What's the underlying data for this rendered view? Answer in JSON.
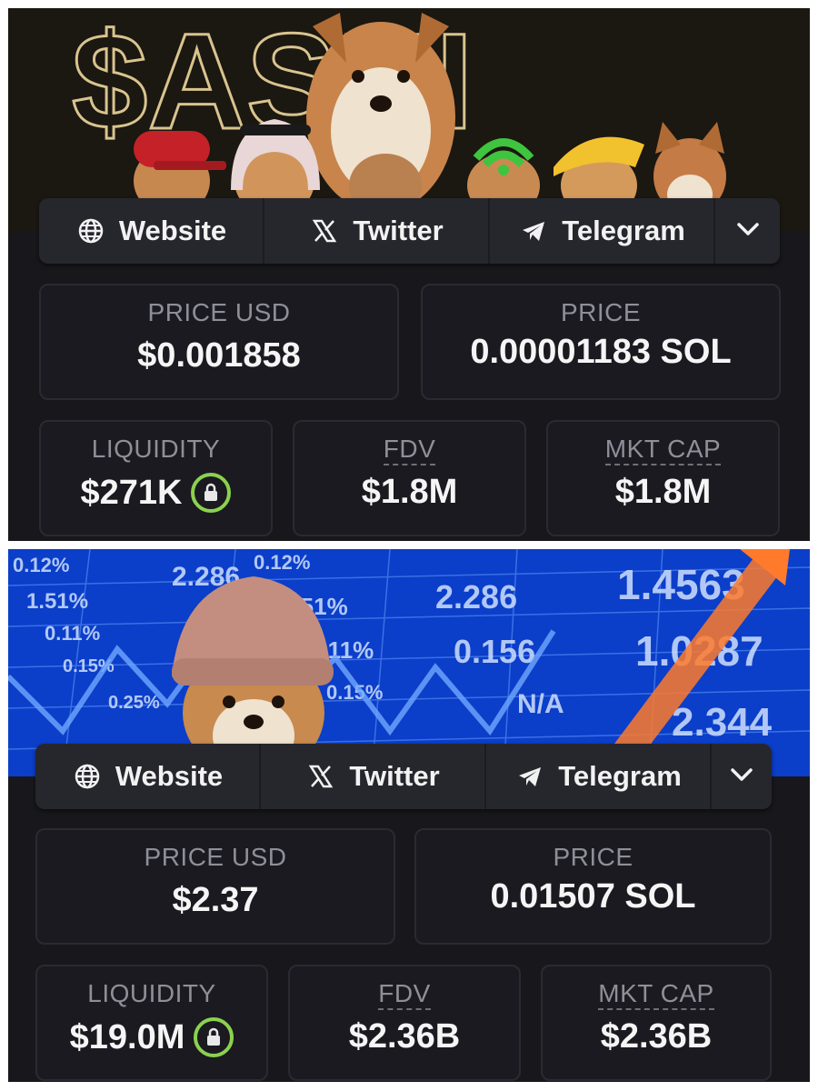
{
  "cards": [
    {
      "links": {
        "website": "Website",
        "twitter": "Twitter",
        "telegram": "Telegram",
        "more_icon": "chevron-down-icon"
      },
      "banner": {
        "logo_text": "$ASHI"
      },
      "price_usd": {
        "label": "PRICE USD",
        "value": "$0.001858"
      },
      "price": {
        "label": "PRICE",
        "value": "0.00001183 SOL"
      },
      "liquidity": {
        "label": "LIQUIDITY",
        "value": "$271K",
        "icon": "lock-icon"
      },
      "fdv": {
        "label": "FDV",
        "value": "$1.8M"
      },
      "mkt_cap": {
        "label": "MKT CAP",
        "value": "$1.8M"
      }
    },
    {
      "links": {
        "website": "Website",
        "twitter": "Twitter",
        "telegram": "Telegram",
        "more_icon": "chevron-down-icon"
      },
      "banner": {
        "ticker_values": [
          "0.12%",
          "2.286",
          "0.12%",
          "1.51%",
          "1.51%",
          "2.286",
          "1.4563",
          "0.11%",
          "0.11%",
          "0.156",
          "1.0287",
          "0.15%",
          "0.15%",
          "0.25%",
          "N/A",
          "2.344"
        ]
      },
      "price_usd": {
        "label": "PRICE USD",
        "value": "$2.37"
      },
      "price": {
        "label": "PRICE",
        "value": "0.01507 SOL"
      },
      "liquidity": {
        "label": "LIQUIDITY",
        "value": "$19.0M",
        "icon": "lock-icon"
      },
      "fdv": {
        "label": "FDV",
        "value": "$2.36B"
      },
      "mkt_cap": {
        "label": "MKT CAP",
        "value": "$2.36B"
      }
    }
  ],
  "colors": {
    "panel_bg": "#17171c",
    "card_bg": "#1a1a20",
    "label": "#8f8f99",
    "lock_ring": "#8bd14e",
    "banner2_bg": "#0b3ec9"
  }
}
